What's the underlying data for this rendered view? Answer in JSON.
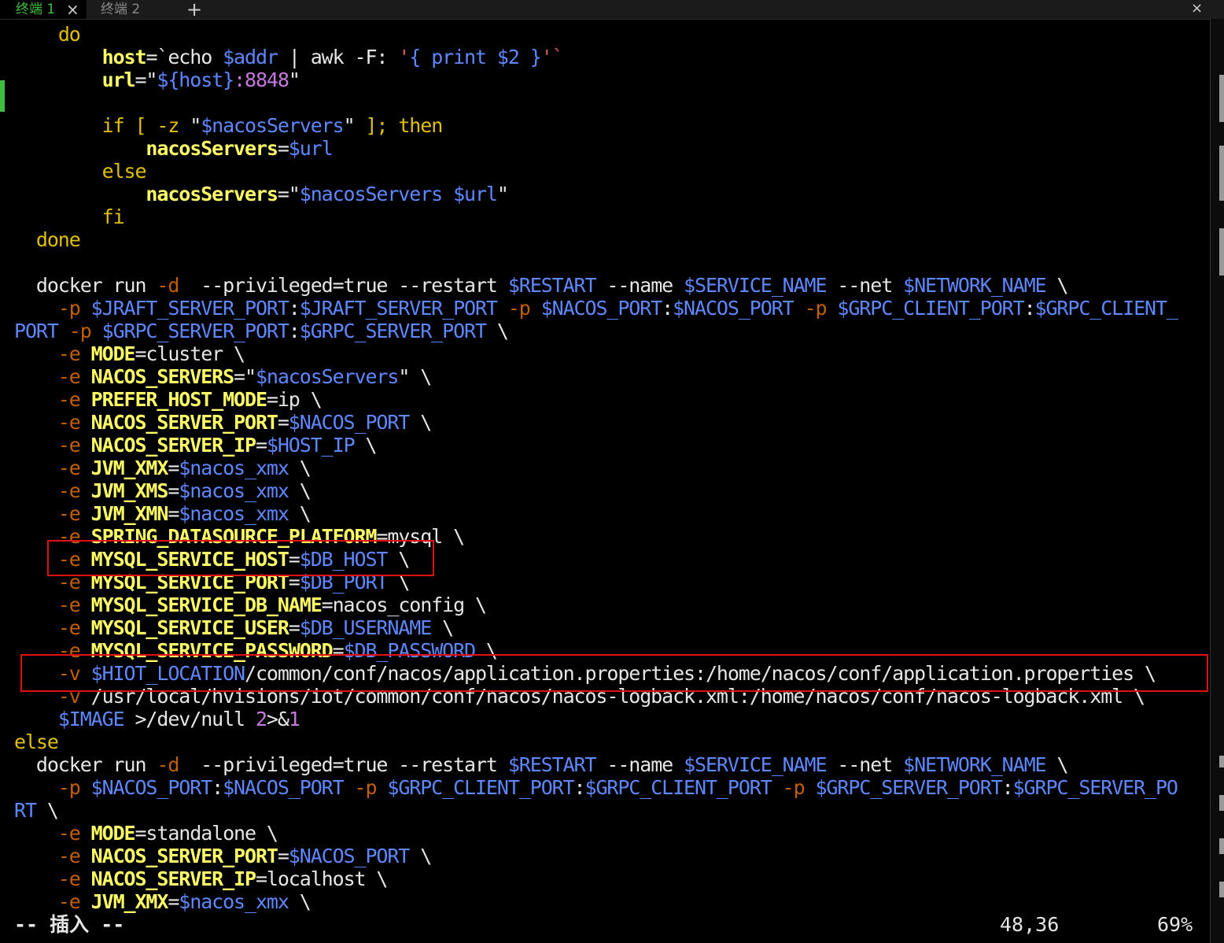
{
  "tabs": [
    {
      "label": "终端",
      "index": "1",
      "close": "×"
    },
    {
      "label": "终端",
      "index": "2"
    }
  ],
  "new_tab_label": "+",
  "window_close_label": "×",
  "code_lines": [
    [
      [
        "    ",
        ""
      ],
      [
        "do",
        "kw"
      ]
    ],
    [
      [
        "        ",
        ""
      ],
      [
        "host",
        "hl"
      ],
      [
        "=`",
        ""
      ],
      [
        "echo ",
        ""
      ],
      [
        "$addr",
        "var"
      ],
      [
        " | awk -F: ",
        ""
      ],
      [
        "'",
        "str"
      ],
      [
        "{ print $2 }",
        "var"
      ],
      [
        "'`",
        "str"
      ]
    ],
    [
      [
        "        ",
        ""
      ],
      [
        "url",
        "hl"
      ],
      [
        "=\"",
        ""
      ],
      [
        "${host}",
        "var"
      ],
      [
        ":8848",
        "num"
      ],
      [
        "\"",
        ""
      ]
    ],
    [
      [
        "",
        ""
      ]
    ],
    [
      [
        "        ",
        ""
      ],
      [
        "if [ -z ",
        "kw"
      ],
      [
        "\"",
        ""
      ],
      [
        "$nacosServers",
        "var"
      ],
      [
        "\"",
        ""
      ],
      [
        " ]; then",
        "kw"
      ]
    ],
    [
      [
        "            ",
        ""
      ],
      [
        "nacosServers",
        "hl"
      ],
      [
        "=",
        ""
      ],
      [
        "$url",
        "var"
      ]
    ],
    [
      [
        "        ",
        ""
      ],
      [
        "else",
        "kw"
      ]
    ],
    [
      [
        "            ",
        ""
      ],
      [
        "nacosServers",
        "hl"
      ],
      [
        "=\"",
        ""
      ],
      [
        "$nacosServers $url",
        "var"
      ],
      [
        "\"",
        ""
      ]
    ],
    [
      [
        "        ",
        ""
      ],
      [
        "fi",
        "kw"
      ]
    ],
    [
      [
        "  ",
        ""
      ],
      [
        "done",
        "kw"
      ]
    ],
    [
      [
        "",
        ""
      ]
    ],
    [
      [
        "  docker run ",
        ""
      ],
      [
        "-d",
        "op"
      ],
      [
        "  --privileged=true --restart ",
        ""
      ],
      [
        "$RESTART",
        "var"
      ],
      [
        " --name ",
        ""
      ],
      [
        "$SERVICE_NAME",
        "var"
      ],
      [
        " --net ",
        ""
      ],
      [
        "$NETWORK_NAME",
        "var"
      ],
      [
        " \\",
        ""
      ]
    ],
    [
      [
        "    ",
        ""
      ],
      [
        "-p",
        "op"
      ],
      [
        " ",
        ""
      ],
      [
        "$JRAFT_SERVER_PORT",
        "var"
      ],
      [
        ":",
        ""
      ],
      [
        "$JRAFT_SERVER_PORT",
        "var"
      ],
      [
        " ",
        ""
      ],
      [
        "-p",
        "op"
      ],
      [
        " ",
        ""
      ],
      [
        "$NACOS_PORT",
        "var"
      ],
      [
        ":",
        ""
      ],
      [
        "$NACOS_PORT",
        "var"
      ],
      [
        " ",
        ""
      ],
      [
        "-p",
        "op"
      ],
      [
        " ",
        ""
      ],
      [
        "$GRPC_CLIENT_PORT",
        "var"
      ],
      [
        ":",
        ""
      ],
      [
        "$GRPC_CLIENT_",
        "var"
      ]
    ],
    [
      [
        "PORT",
        "var"
      ],
      [
        " ",
        ""
      ],
      [
        "-p",
        "op"
      ],
      [
        " ",
        ""
      ],
      [
        "$GRPC_SERVER_PORT",
        "var"
      ],
      [
        ":",
        ""
      ],
      [
        "$GRPC_SERVER_PORT",
        "var"
      ],
      [
        " \\",
        ""
      ]
    ],
    [
      [
        "    ",
        ""
      ],
      [
        "-e",
        "op"
      ],
      [
        " ",
        ""
      ],
      [
        "MODE",
        "hl"
      ],
      [
        "=cluster \\",
        ""
      ]
    ],
    [
      [
        "    ",
        ""
      ],
      [
        "-e",
        "op"
      ],
      [
        " ",
        ""
      ],
      [
        "NACOS_SERVERS",
        "hl"
      ],
      [
        "=\"",
        ""
      ],
      [
        "$nacosServers",
        "var"
      ],
      [
        "\" \\",
        ""
      ]
    ],
    [
      [
        "    ",
        ""
      ],
      [
        "-e",
        "op"
      ],
      [
        " ",
        ""
      ],
      [
        "PREFER_HOST_MODE",
        "hl"
      ],
      [
        "=ip \\",
        ""
      ]
    ],
    [
      [
        "    ",
        ""
      ],
      [
        "-e",
        "op"
      ],
      [
        " ",
        ""
      ],
      [
        "NACOS_SERVER_PORT",
        "hl"
      ],
      [
        "=",
        ""
      ],
      [
        "$NACOS_PORT",
        "var"
      ],
      [
        " \\",
        ""
      ]
    ],
    [
      [
        "    ",
        ""
      ],
      [
        "-e",
        "op"
      ],
      [
        " ",
        ""
      ],
      [
        "NACOS_SERVER_IP",
        "hl"
      ],
      [
        "=",
        ""
      ],
      [
        "$HOST_IP",
        "var"
      ],
      [
        " \\",
        ""
      ]
    ],
    [
      [
        "    ",
        ""
      ],
      [
        "-e",
        "op"
      ],
      [
        " ",
        ""
      ],
      [
        "JVM_XMX",
        "hl"
      ],
      [
        "=",
        ""
      ],
      [
        "$nacos_xmx",
        "var"
      ],
      [
        " \\",
        ""
      ]
    ],
    [
      [
        "    ",
        ""
      ],
      [
        "-e",
        "op"
      ],
      [
        " ",
        ""
      ],
      [
        "JVM_XMS",
        "hl"
      ],
      [
        "=",
        ""
      ],
      [
        "$nacos_xmx",
        "var"
      ],
      [
        " \\",
        ""
      ]
    ],
    [
      [
        "    ",
        ""
      ],
      [
        "-e",
        "op"
      ],
      [
        " ",
        ""
      ],
      [
        "JVM_XMN",
        "hl"
      ],
      [
        "=",
        ""
      ],
      [
        "$nacos_xmx",
        "var"
      ],
      [
        " \\",
        ""
      ]
    ],
    [
      [
        "    ",
        ""
      ],
      [
        "-e",
        "op"
      ],
      [
        " ",
        ""
      ],
      [
        "SPRING_DATASOURCE_PLATFORM",
        "hl"
      ],
      [
        "=mysql \\",
        ""
      ]
    ],
    [
      [
        "    ",
        ""
      ],
      [
        "-e",
        "op"
      ],
      [
        " ",
        ""
      ],
      [
        "MYSQL_SERVICE_HOST",
        "hl"
      ],
      [
        "=",
        ""
      ],
      [
        "$DB_HOST",
        "var"
      ],
      [
        " \\",
        ""
      ]
    ],
    [
      [
        "    ",
        ""
      ],
      [
        "-e",
        "op"
      ],
      [
        " ",
        ""
      ],
      [
        "MYSQL_SERVICE_PORT",
        "hl"
      ],
      [
        "=",
        ""
      ],
      [
        "$DB_PORT",
        "var"
      ],
      [
        " \\",
        ""
      ]
    ],
    [
      [
        "    ",
        ""
      ],
      [
        "-e",
        "op"
      ],
      [
        " ",
        ""
      ],
      [
        "MYSQL_SERVICE_DB_NAME",
        "hl"
      ],
      [
        "=nacos_config \\",
        ""
      ]
    ],
    [
      [
        "    ",
        ""
      ],
      [
        "-e",
        "op"
      ],
      [
        " ",
        ""
      ],
      [
        "MYSQL_SERVICE_USER",
        "hl"
      ],
      [
        "=",
        ""
      ],
      [
        "$DB_USERNAME",
        "var"
      ],
      [
        " \\",
        ""
      ]
    ],
    [
      [
        "    ",
        ""
      ],
      [
        "-e",
        "op"
      ],
      [
        " ",
        ""
      ],
      [
        "MYSQL_SERVICE_PASSWORD",
        "hl"
      ],
      [
        "=",
        ""
      ],
      [
        "$DB_PASSWORD",
        "var"
      ],
      [
        " \\",
        ""
      ]
    ],
    [
      [
        "    ",
        ""
      ],
      [
        "-v",
        "op"
      ],
      [
        " ",
        ""
      ],
      [
        "$HIOT_LOCATION",
        "var"
      ],
      [
        "/common/conf/nacos/application.properties:/home/nacos/conf/application.properties \\",
        ""
      ]
    ],
    [
      [
        "    ",
        ""
      ],
      [
        "-v",
        "op"
      ],
      [
        " /usr/local/hvisions/iot/common/conf/nacos/nacos-logback.xml:/home/nacos/conf/nacos-logback.xml \\",
        ""
      ]
    ],
    [
      [
        "    ",
        ""
      ],
      [
        "$IMAGE",
        "var"
      ],
      [
        " >/dev/null ",
        ""
      ],
      [
        "2",
        "num"
      ],
      [
        ">&",
        ""
      ],
      [
        "1",
        "num"
      ]
    ],
    [
      [
        "else",
        "kw"
      ]
    ],
    [
      [
        "  docker run ",
        ""
      ],
      [
        "-d",
        "op"
      ],
      [
        "  --privileged=true --restart ",
        ""
      ],
      [
        "$RESTART",
        "var"
      ],
      [
        " --name ",
        ""
      ],
      [
        "$SERVICE_NAME",
        "var"
      ],
      [
        " --net ",
        ""
      ],
      [
        "$NETWORK_NAME",
        "var"
      ],
      [
        " \\",
        ""
      ]
    ],
    [
      [
        "    ",
        ""
      ],
      [
        "-p",
        "op"
      ],
      [
        " ",
        ""
      ],
      [
        "$NACOS_PORT",
        "var"
      ],
      [
        ":",
        ""
      ],
      [
        "$NACOS_PORT",
        "var"
      ],
      [
        " ",
        ""
      ],
      [
        "-p",
        "op"
      ],
      [
        " ",
        ""
      ],
      [
        "$GRPC_CLIENT_PORT",
        "var"
      ],
      [
        ":",
        ""
      ],
      [
        "$GRPC_CLIENT_PORT",
        "var"
      ],
      [
        " ",
        ""
      ],
      [
        "-p",
        "op"
      ],
      [
        " ",
        ""
      ],
      [
        "$GRPC_SERVER_PORT",
        "var"
      ],
      [
        ":",
        ""
      ],
      [
        "$GRPC_SERVER_PO",
        "var"
      ]
    ],
    [
      [
        "RT",
        "var"
      ],
      [
        " \\",
        ""
      ]
    ],
    [
      [
        "    ",
        ""
      ],
      [
        "-e",
        "op"
      ],
      [
        " ",
        ""
      ],
      [
        "MODE",
        "hl"
      ],
      [
        "=standalone \\",
        ""
      ]
    ],
    [
      [
        "    ",
        ""
      ],
      [
        "-e",
        "op"
      ],
      [
        " ",
        ""
      ],
      [
        "NACOS_SERVER_PORT",
        "hl"
      ],
      [
        "=",
        ""
      ],
      [
        "$NACOS_PORT",
        "var"
      ],
      [
        " \\",
        ""
      ]
    ],
    [
      [
        "    ",
        ""
      ],
      [
        "-e",
        "op"
      ],
      [
        " ",
        ""
      ],
      [
        "NACOS_SERVER_IP",
        "hl"
      ],
      [
        "=localhost \\",
        ""
      ]
    ],
    [
      [
        "    ",
        ""
      ],
      [
        "-e",
        "op"
      ],
      [
        " ",
        ""
      ],
      [
        "JVM_XMX",
        "hl"
      ],
      [
        "=",
        ""
      ],
      [
        "$nacos_xmx",
        "var"
      ],
      [
        " \\",
        ""
      ]
    ]
  ],
  "status": {
    "mode": "-- 插入 --",
    "position": "48,36",
    "percent": "69%"
  },
  "colors": {
    "background": "#000000",
    "keyword": "#e0c000",
    "variable": "#5f87ff",
    "string": "#d75f5f",
    "number": "#c678dd",
    "option": "#c06000",
    "highlight_box": "#e01010",
    "active_tab": "#3fbf3f"
  }
}
